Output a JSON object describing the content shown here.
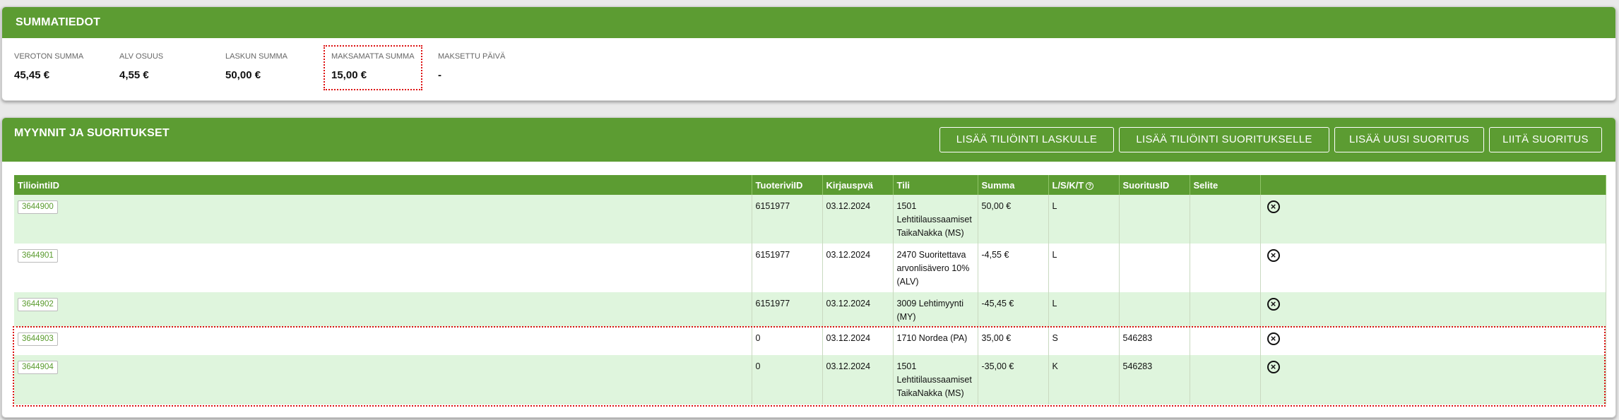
{
  "summary": {
    "title": "SUMMATIEDOT",
    "items": [
      {
        "label": "VEROTON SUMMA",
        "value": "45,45 €"
      },
      {
        "label": "ALV OSUUS",
        "value": "4,55 €"
      },
      {
        "label": "LASKUN SUMMA",
        "value": "50,00 €"
      },
      {
        "label": "MAKSAMATTA SUMMA",
        "value": "15,00 €"
      },
      {
        "label": "MAKSETTU PÄIVÄ",
        "value": "-"
      }
    ]
  },
  "sales": {
    "title": "MYYNNIT JA SUORITUKSET",
    "buttons": {
      "add_posting_invoice": "LISÄÄ TILIÖINTI LASKULLE",
      "add_posting_payment": "LISÄÄ TILIÖINTI SUORITUKSELLE",
      "add_new_payment": "LISÄÄ UUSI SUORITUS",
      "attach_payment": "LIITÄ SUORITUS"
    },
    "columns": [
      "TiliointiID",
      "TuoteriviID",
      "Kirjauspvä",
      "Tili",
      "Summa",
      "L/S/K/T",
      "SuoritusID",
      "Selite",
      ""
    ],
    "rows": [
      {
        "id": "3644900",
        "tuoterivi": "6151977",
        "pvm": "03.12.2024",
        "tili": "1501 Lehtitilaussaamiset TaikaNakka (MS)",
        "summa": "50,00 €",
        "lskt": "L",
        "suoritus": "",
        "selite": ""
      },
      {
        "id": "3644901",
        "tuoterivi": "6151977",
        "pvm": "03.12.2024",
        "tili": "2470 Suoritettava arvonlisävero 10% (ALV)",
        "summa": "-4,55 €",
        "lskt": "L",
        "suoritus": "",
        "selite": ""
      },
      {
        "id": "3644902",
        "tuoterivi": "6151977",
        "pvm": "03.12.2024",
        "tili": "3009 Lehtimyynti (MY)",
        "summa": "-45,45 €",
        "lskt": "L",
        "suoritus": "",
        "selite": ""
      },
      {
        "id": "3644903",
        "tuoterivi": "0",
        "pvm": "03.12.2024",
        "tili": "1710 Nordea (PA)",
        "summa": "35,00 €",
        "lskt": "S",
        "suoritus": "546283",
        "selite": ""
      },
      {
        "id": "3644904",
        "tuoterivi": "0",
        "pvm": "03.12.2024",
        "tili": "1501 Lehtitilaussaamiset TaikaNakka (MS)",
        "summa": "-35,00 €",
        "lskt": "K",
        "suoritus": "546283",
        "selite": ""
      }
    ]
  },
  "colors": {
    "accent": "#5c9c32",
    "row_alt": "#dff5dd",
    "highlight": "#dd1111"
  },
  "icons": {
    "delete": "circle-x-icon",
    "help": "question-circle-icon"
  }
}
